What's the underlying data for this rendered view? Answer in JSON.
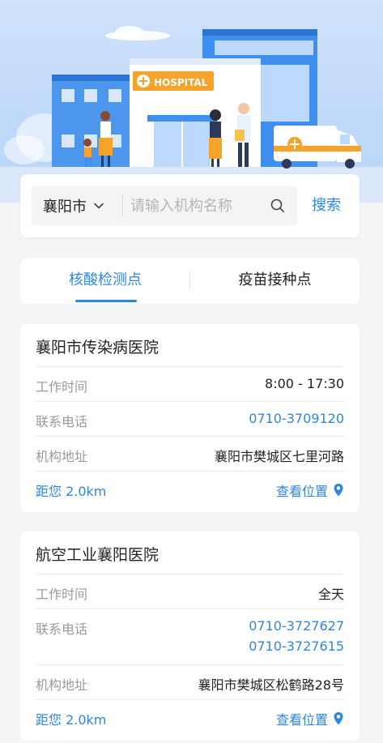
{
  "hero": {
    "building_sign": "HOSPITAL"
  },
  "search": {
    "city": "襄阳市",
    "placeholder": "请输入机构名称",
    "button": "搜索"
  },
  "tabs": [
    {
      "label": "核酸检测点",
      "active": true
    },
    {
      "label": "疫苗接种点",
      "active": false
    }
  ],
  "colors": {
    "accent": "#2f86e0",
    "hero_bg": "#b7d4f8"
  },
  "cards": [
    {
      "name": "襄阳市传染病医院",
      "rows": [
        {
          "label": "工作时间",
          "value": "8:00 - 17:30"
        },
        {
          "label": "联系电话",
          "value": "0710-3709120"
        },
        {
          "label": "机构地址",
          "value": "襄阳市樊城区七里河路"
        }
      ],
      "distance": "距您 2.0km",
      "view_location": "查看位置"
    },
    {
      "name": "航空工业襄阳医院",
      "rows": [
        {
          "label": "工作时间",
          "value": "全天"
        },
        {
          "label": "联系电话",
          "value": "0710-3727627",
          "value2": "0710-3727615"
        },
        {
          "label": "机构地址",
          "value": "襄阳市樊城区松鹤路28号"
        }
      ],
      "distance": "距您 2.0km",
      "view_location": "查看位置"
    }
  ]
}
